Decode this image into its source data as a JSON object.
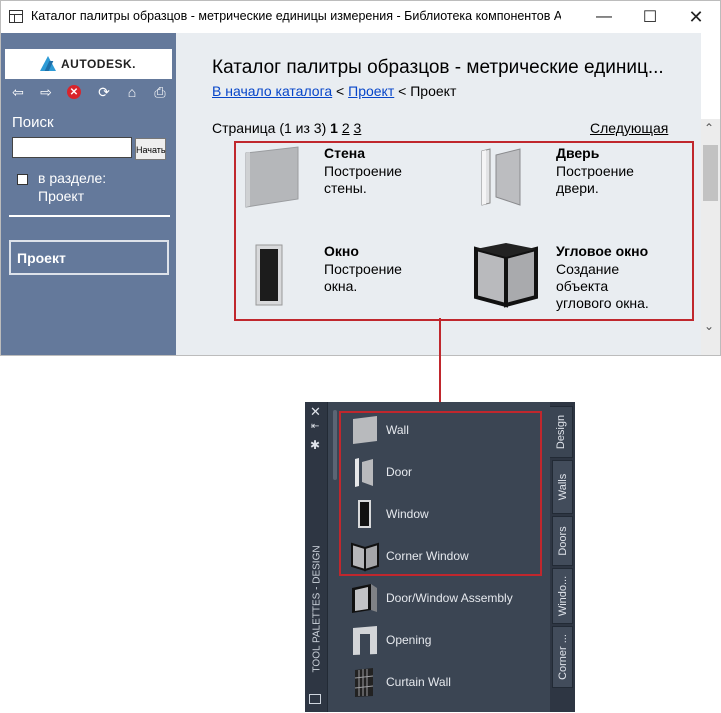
{
  "window": {
    "title": "Каталог палитры образцов - метрические единицы измерения - Библиотека компонентов Autode...",
    "controls": {
      "minimize": "—",
      "maximize": "☐",
      "close": "✕"
    }
  },
  "sidebar": {
    "logo_text": "AUTODESK.",
    "nav": {
      "back": "⇦",
      "forward": "⇨",
      "stop": "✕",
      "refresh": "⟳",
      "home": "⌂",
      "print": "⎙"
    },
    "search_label": "Поиск",
    "search_value": "",
    "search_button": "Начать",
    "in_section_label": "в разделе:",
    "in_section_value": "Проект",
    "project_button": "Проект"
  },
  "main": {
    "title": "Каталог палитры образцов - метрические единиц...",
    "breadcrumb": {
      "home_link": "В начало каталога",
      "sep1": " < ",
      "project_link": "Проект",
      "sep2": " < ",
      "current": "Проект"
    },
    "pager": {
      "text": "Страница (1 из 3) ",
      "current": "1",
      "p2": "2",
      "p3": "3"
    },
    "next": "Следующая",
    "items": [
      {
        "title": "Стена",
        "desc1": "Построение",
        "desc2": "стены.",
        "desc3": ""
      },
      {
        "title": "Дверь",
        "desc1": "Построение",
        "desc2": "двери.",
        "desc3": ""
      },
      {
        "title": "Окно",
        "desc1": "Построение",
        "desc2": "окна.",
        "desc3": ""
      },
      {
        "title": "Угловое окно",
        "desc1": "Создание",
        "desc2": "объекта",
        "desc3": "углового окна."
      }
    ],
    "scroll": {
      "up": "⌃",
      "down": "⌄"
    }
  },
  "palette": {
    "close": "✕",
    "pin": "⇤",
    "gear": "✱",
    "vertical_label": "TOOL PALETTES - DESIGN",
    "items": [
      "Wall",
      "Door",
      "Window",
      "Corner Window",
      "Door/Window Assembly",
      "Opening",
      "Curtain Wall"
    ],
    "tabs": [
      "Design",
      "Walls",
      "Doors",
      "Windo...",
      "Corner ..."
    ]
  }
}
